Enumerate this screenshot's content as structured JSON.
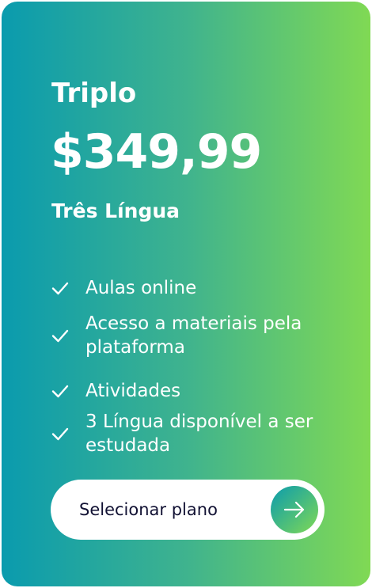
{
  "plan": {
    "name": "Triplo",
    "price": "$349,99",
    "subtitle": "Três  Língua",
    "features": [
      "Aulas online",
      "Acesso a materiais pela plataforma",
      "Atividades",
      "3 Língua disponível a ser estudada"
    ],
    "button_label": "Selecionar plano"
  },
  "icons": {
    "feature_icon": "check-icon",
    "button_icon": "arrow-right-icon"
  },
  "colors": {
    "gradient_start": "#0a9bae",
    "gradient_end": "#80d954",
    "button_background": "#ffffff",
    "button_text": "#111133"
  }
}
